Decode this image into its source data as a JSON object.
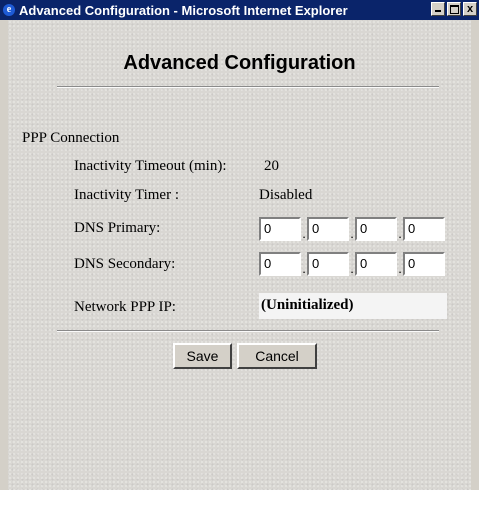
{
  "window": {
    "title": "Advanced Configuration - Microsoft Internet Explorer",
    "buttons": {
      "minimize": "minimize",
      "maximize": "maximize",
      "close": "x"
    }
  },
  "page": {
    "heading": "Advanced Configuration",
    "section_label": "PPP Connection",
    "fields": {
      "inactivity_timeout": {
        "label": "Inactivity Timeout (min):",
        "value": "20"
      },
      "inactivity_timer": {
        "label": "Inactivity Timer :",
        "value": "Disabled"
      },
      "dns_primary": {
        "label": "DNS Primary:",
        "octets": [
          "0",
          "0",
          "0",
          "0"
        ]
      },
      "dns_secondary": {
        "label": "DNS Secondary:",
        "octets": [
          "0",
          "0",
          "0",
          "0"
        ]
      },
      "network_ppp_ip": {
        "label": "Network PPP IP:",
        "value": "(Uninitialized)"
      }
    },
    "buttons": {
      "save": "Save",
      "cancel": "Cancel"
    },
    "ip_separator": "."
  },
  "icons": {
    "app": "internet-explorer-icon",
    "app_glyph": "e"
  },
  "colors": {
    "titlebar": "#0a246a",
    "window_face": "#d4d0c8"
  }
}
